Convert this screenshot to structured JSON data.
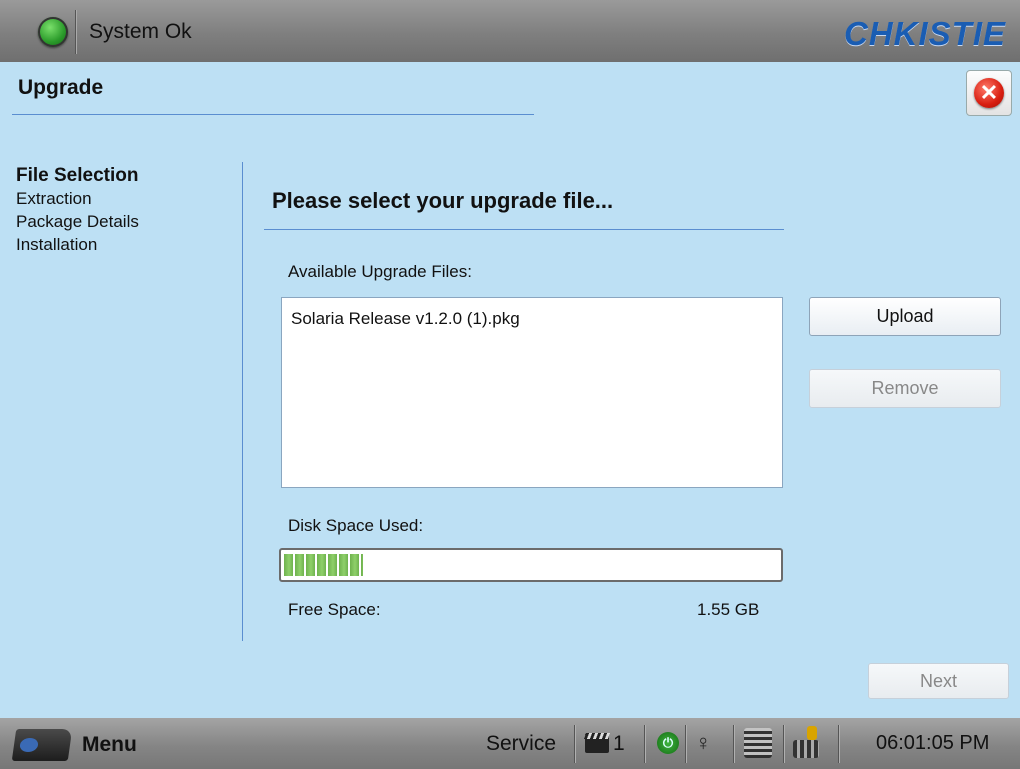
{
  "topbar": {
    "status_text": "System Ok",
    "status_color": "#2a9a2a",
    "logo_text": "CHKISTIE",
    "logo_color": "#1a5db3"
  },
  "header": {
    "title": "Upgrade",
    "close_icon": "close-icon"
  },
  "steps": [
    {
      "label": "File Selection",
      "active": true
    },
    {
      "label": "Extraction",
      "active": false
    },
    {
      "label": "Package Details",
      "active": false
    },
    {
      "label": "Installation",
      "active": false
    }
  ],
  "main": {
    "heading": "Please select your upgrade file...",
    "files_label": "Available Upgrade Files:",
    "files": [
      "Solaria Release v1.2.0 (1).pkg"
    ],
    "upload_label": "Upload",
    "remove_label": "Remove",
    "disk_label": "Disk Space Used:",
    "disk_used_percent": 16,
    "free_label": "Free Space:",
    "free_value": "1.55 GB",
    "next_label": "Next"
  },
  "bottombar": {
    "menu_label": "Menu",
    "mode_label": "Service",
    "channel": "1",
    "time": "06:01:05 PM",
    "icons": [
      "menu-icon",
      "film-icon",
      "power-icon",
      "bulb-icon",
      "shutter-icon",
      "douser-icon"
    ]
  },
  "colors": {
    "background": "#bde0f4",
    "rule": "#5a8ed0",
    "disk_fill": "#6fb24e"
  }
}
